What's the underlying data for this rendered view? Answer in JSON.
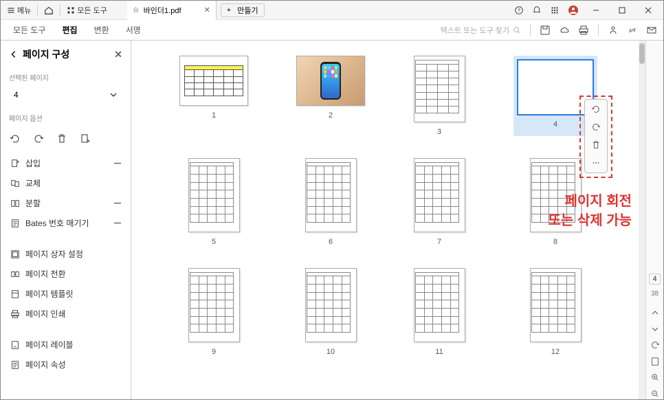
{
  "titlebar": {
    "menu": "메뉴",
    "all_tools": "모든 도구",
    "tab_title": "바인더1.pdf",
    "create": "만들기"
  },
  "toolbar": {
    "tabs": [
      "모든 도구",
      "편집",
      "변환",
      "서명"
    ],
    "active_tab_index": 1,
    "search_placeholder": "텍스트 또는 도구 찾기"
  },
  "sidebar": {
    "title": "페이지 구성",
    "selected_label": "선택된 페이지",
    "selected_value": "4",
    "options_label": "페이지 옵션",
    "items_a": [
      "삽입",
      "교체",
      "분할",
      "Bates 번호 매기기"
    ],
    "items_b": [
      "페이지 상자 설정",
      "페이지 전환",
      "페이지 템플릿",
      "페이지 인쇄"
    ],
    "items_c": [
      "페이지 레이블",
      "페이지 속성"
    ]
  },
  "pages": {
    "selected": 4,
    "total": 38,
    "numbers": [
      1,
      2,
      3,
      4,
      5,
      6,
      7,
      8,
      9,
      10,
      11,
      12
    ]
  },
  "annotation": {
    "line1": "페이지 회전",
    "line2": "또는 삭제 가능"
  },
  "rail": {
    "current": "4",
    "total": "38"
  }
}
